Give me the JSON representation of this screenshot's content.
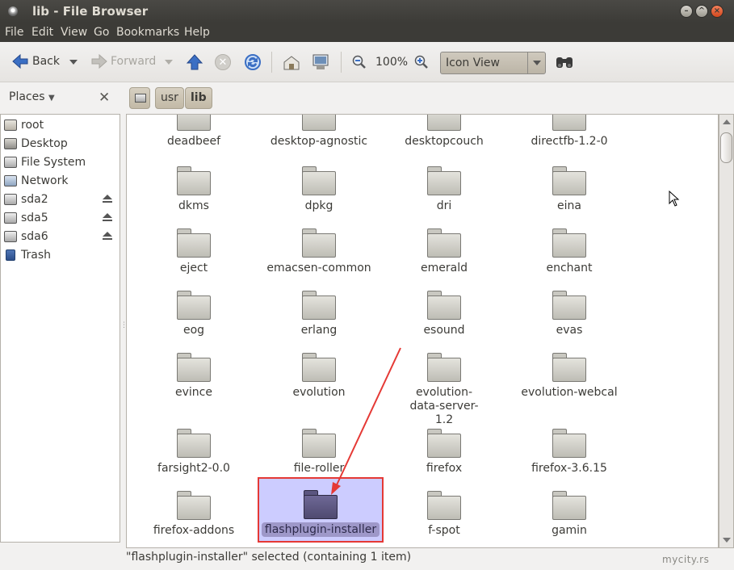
{
  "window": {
    "title": "lib - File Browser"
  },
  "menu": [
    "File",
    "Edit",
    "View",
    "Go",
    "Bookmarks",
    "Help"
  ],
  "toolbar": {
    "back": "Back",
    "forward": "Forward",
    "zoom": "100%",
    "view_mode": "Icon View"
  },
  "places": {
    "header": "Places",
    "items": [
      {
        "label": "root",
        "icon": "home-icon"
      },
      {
        "label": "Desktop",
        "icon": "desktop-icon"
      },
      {
        "label": "File System",
        "icon": "drive-icon"
      },
      {
        "label": "Network",
        "icon": "network-icon"
      },
      {
        "label": "sda2",
        "icon": "disk-icon",
        "eject": true
      },
      {
        "label": "sda5",
        "icon": "disk-icon",
        "eject": true
      },
      {
        "label": "sda6",
        "icon": "disk-icon",
        "eject": true
      },
      {
        "label": "Trash",
        "icon": "trash-icon"
      }
    ]
  },
  "path": [
    "usr",
    "lib"
  ],
  "files": [
    [
      "deadbeef",
      "desktop-agnostic",
      "desktopcouch",
      "directfb-1.2-0"
    ],
    [
      "dkms",
      "dpkg",
      "dri",
      "eina"
    ],
    [
      "eject",
      "emacsen-common",
      "emerald",
      "enchant"
    ],
    [
      "eog",
      "erlang",
      "esound",
      "evas"
    ],
    [
      "evince",
      "evolution",
      "evolution-data-server-1.2",
      "evolution-webcal"
    ],
    [
      "farsight2-0.0",
      "file-roller",
      "firefox",
      "firefox-3.6.15"
    ],
    [
      "firefox-addons",
      "flashplugin-installer",
      "f-spot",
      "gamin"
    ]
  ],
  "selected_file": "flashplugin-installer",
  "status": "\"flashplugin-installer\" selected (containing 1 item)",
  "watermark": "mycity.rs"
}
